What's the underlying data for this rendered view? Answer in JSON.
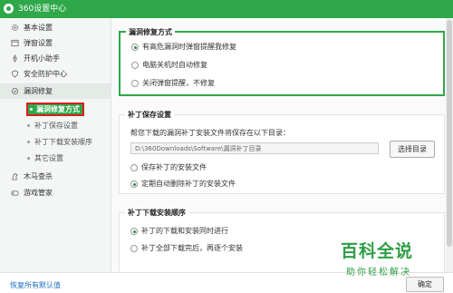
{
  "window": {
    "title": "360设置中心"
  },
  "sidebar": {
    "items": [
      {
        "label": "基本设置",
        "icon": "gear-icon"
      },
      {
        "label": "弹窗设置",
        "icon": "window-icon"
      },
      {
        "label": "开机小助手",
        "icon": "rocket-icon"
      },
      {
        "label": "安全防护中心",
        "icon": "shield-icon"
      },
      {
        "label": "漏洞修复",
        "icon": "wrench-icon"
      }
    ],
    "subitems": [
      {
        "label": "漏洞修复方式",
        "selected": true
      },
      {
        "label": "补丁保存设置"
      },
      {
        "label": "补丁下载安装顺序"
      },
      {
        "label": "其它设置"
      }
    ],
    "items2": [
      {
        "label": "木马查杀",
        "icon": "horse-icon"
      },
      {
        "label": "游戏管家",
        "icon": "gamepad-icon"
      }
    ]
  },
  "sections": {
    "fix_mode": {
      "title": "漏洞修复方式",
      "options": [
        {
          "label": "有高危漏洞时弹窗提醒我修复",
          "checked": true
        },
        {
          "label": "电脑关机时自动修复",
          "checked": false
        },
        {
          "label": "关闭弹窗提醒，不修复",
          "checked": false
        }
      ]
    },
    "patch_save": {
      "title": "补丁保存设置",
      "description": "帮您下载的漏洞补丁安装文件将保存在以下目录：",
      "path": "D:\\360Downloads\\Software\\漏洞补丁目录",
      "browse_label": "选择目录",
      "options": [
        {
          "label": "保存补丁的安装文件",
          "checked": false
        },
        {
          "label": "定期自动删除补丁的安装文件",
          "checked": true
        }
      ]
    },
    "install_order": {
      "title": "补丁下载安装顺序",
      "options": [
        {
          "label": "补丁的下载和安装同时进行",
          "checked": true
        },
        {
          "label": "补丁全部下载完后，再逐个安装",
          "checked": false
        }
      ]
    }
  },
  "footer": {
    "restore_label": "恢复所有默认值",
    "confirm_label": "确定"
  },
  "watermark": {
    "title": "百科全说",
    "subtitle": "助你轻松解决"
  },
  "colors": {
    "brand_green": "#2fa84a",
    "highlight_red": "#d81f1f",
    "link_blue": "#1a6fc2"
  }
}
